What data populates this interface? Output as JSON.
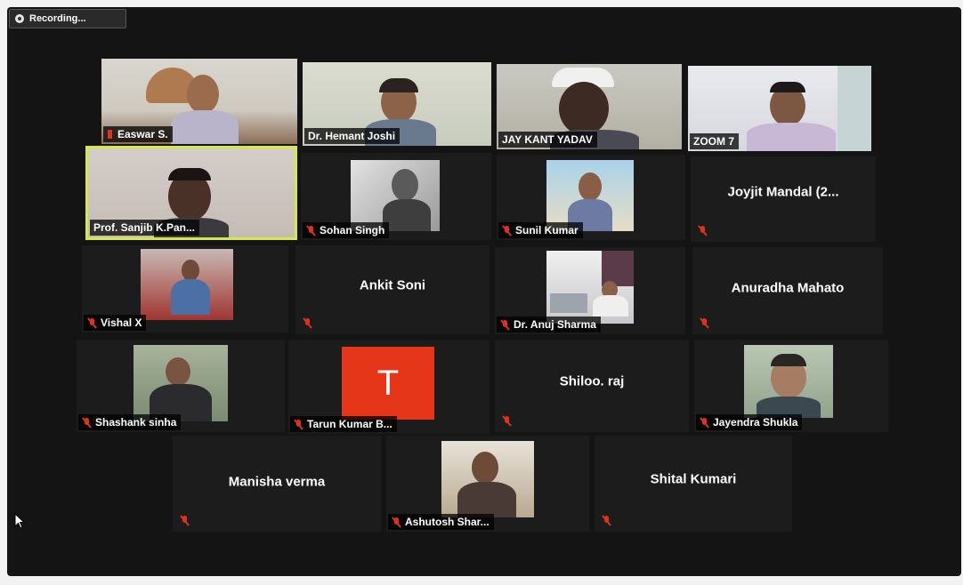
{
  "recording": {
    "label": "Recording..."
  },
  "colors": {
    "active_speaker": "#d4e84a",
    "mute": "#e0321a",
    "avatar_bg": "#e5361a"
  },
  "participants": [
    {
      "name": "Easwar S.",
      "video": true
    },
    {
      "name": "Dr. Hemant Joshi",
      "video": true
    },
    {
      "name": "JAY KANT YADAV",
      "video": true
    },
    {
      "name": "ZOOM 7",
      "video": true
    },
    {
      "name": "Prof. Sanjib K.Pan...",
      "video": true,
      "active": true
    },
    {
      "name": "Sohan Singh",
      "video": true,
      "muted": true
    },
    {
      "name": "Sunil Kumar",
      "video": true,
      "muted": true
    },
    {
      "name": "Joyjit Mandal (2...",
      "video": false,
      "muted": true
    },
    {
      "name": "Vishal X",
      "video": true,
      "muted": true
    },
    {
      "name": "Ankit Soni",
      "video": false,
      "muted": true
    },
    {
      "name": "Dr. Anuj Sharma",
      "video": true,
      "muted": true
    },
    {
      "name": "Anuradha Mahato",
      "video": false,
      "muted": true
    },
    {
      "name": "Shashank sinha",
      "video": true,
      "muted": true
    },
    {
      "name": "Tarun Kumar B...",
      "video": false,
      "avatar_letter": "T",
      "muted": true
    },
    {
      "name": "Shiloo. raj",
      "video": false,
      "muted": true
    },
    {
      "name": "Jayendra Shukla",
      "video": true,
      "muted": true
    },
    {
      "name": "Manisha verma",
      "video": false,
      "muted": true
    },
    {
      "name": "Ashutosh Shar...",
      "video": true,
      "muted": true
    },
    {
      "name": "Shital Kumari",
      "video": false,
      "muted": true
    }
  ]
}
